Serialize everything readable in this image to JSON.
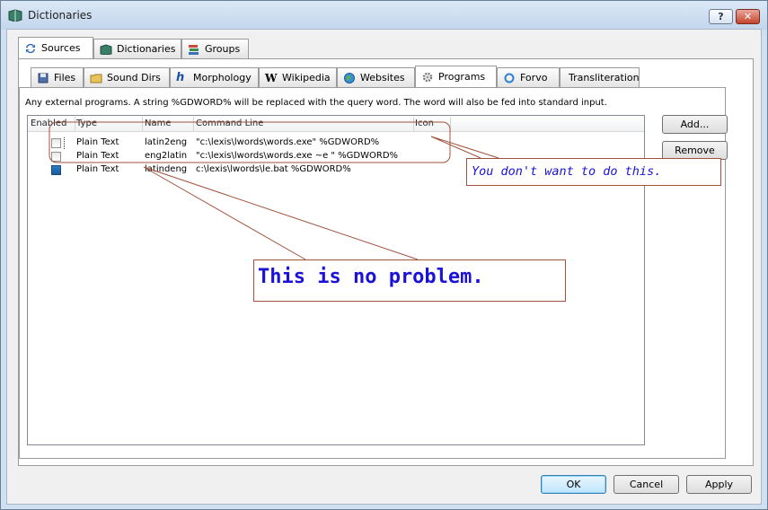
{
  "window": {
    "title": "Dictionaries",
    "help_label": "?",
    "close_label": "✕"
  },
  "outer_tabs": [
    {
      "label": "Sources",
      "icon": "sources-icon",
      "active": true
    },
    {
      "label": "Dictionaries",
      "icon": "book-icon",
      "active": false
    },
    {
      "label": "Groups",
      "icon": "groups-icon",
      "active": false
    }
  ],
  "inner_tabs": [
    {
      "label": "Files",
      "icon": "files-icon",
      "active": false
    },
    {
      "label": "Sound Dirs",
      "icon": "folder-icon",
      "active": false
    },
    {
      "label": "Morphology",
      "icon": "morphology-icon",
      "active": false
    },
    {
      "label": "Wikipedia",
      "icon": "wikipedia-icon",
      "active": false
    },
    {
      "label": "Websites",
      "icon": "globe-icon",
      "active": false
    },
    {
      "label": "Programs",
      "icon": "gear-icon",
      "active": true
    },
    {
      "label": "Forvo",
      "icon": "forvo-icon",
      "active": false
    },
    {
      "label": "Transliteration",
      "icon": "",
      "active": false
    }
  ],
  "programs": {
    "description": "Any external programs. A string %GDWORD% will be replaced with the query word. The word will also be fed into standard input.",
    "columns": [
      "Enabled",
      "Type",
      "Name",
      "Command Line",
      "Icon"
    ],
    "rows": [
      {
        "enabled": false,
        "type": "Plain Text",
        "name": "latin2eng",
        "command": "\"c:\\lexis\\lwords\\words.exe\" %GDWORD%",
        "icon": ""
      },
      {
        "enabled": false,
        "type": "Plain Text",
        "name": "eng2latin",
        "command": "\"c:\\lexis\\lwords\\words.exe ~e \" %GDWORD%",
        "icon": ""
      },
      {
        "enabled": true,
        "type": "Plain Text",
        "name": "latindeng",
        "command": "c:\\lexis\\lwords\\le.bat %GDWORD%",
        "icon": ""
      }
    ],
    "add_label": "Add...",
    "remove_label": "Remove"
  },
  "annotations": {
    "warning": "You don't want to do this.",
    "ok_note": "This is no problem."
  },
  "footer": {
    "ok_label": "OK",
    "cancel_label": "Cancel",
    "apply_label": "Apply"
  },
  "colors": {
    "annotation_text": "#1a12d6",
    "annotation_line": "#a0523a"
  }
}
